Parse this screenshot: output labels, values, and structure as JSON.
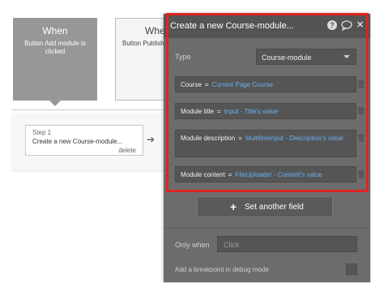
{
  "workflow": {
    "event1": {
      "title": "When",
      "description": "Button Add module is clicked"
    },
    "event2": {
      "title": "When",
      "description": "Button Publish is clicked"
    },
    "step": {
      "number_label": "Step 1",
      "title": "Create a new Course-module...",
      "delete_label": "delete"
    }
  },
  "panel": {
    "title": "Create a new Course-module...",
    "icons": [
      "help-icon",
      "comment-icon",
      "close-icon"
    ],
    "type": {
      "label": "Type",
      "value": "Course-module"
    },
    "fields": [
      {
        "key": "Course",
        "eq": "=",
        "expr": "Current Page Course"
      },
      {
        "key": "Module title",
        "eq": "=",
        "expr": "Input - Title's value"
      },
      {
        "key": "Module description",
        "eq": "=",
        "expr": "MultilineInput - Description's value"
      },
      {
        "key": "Module content",
        "eq": "=",
        "expr": "FileUploader - Content's value"
      }
    ],
    "set_another_field_label": "Set another field",
    "only_when": {
      "label": "Only when",
      "placeholder": "Click"
    },
    "breakpoint_label": "Add a breakpoint in debug mode"
  },
  "colors": {
    "highlight": "#e0241f",
    "expression": "#6ab2f2",
    "panel": "#6c6c6c"
  }
}
